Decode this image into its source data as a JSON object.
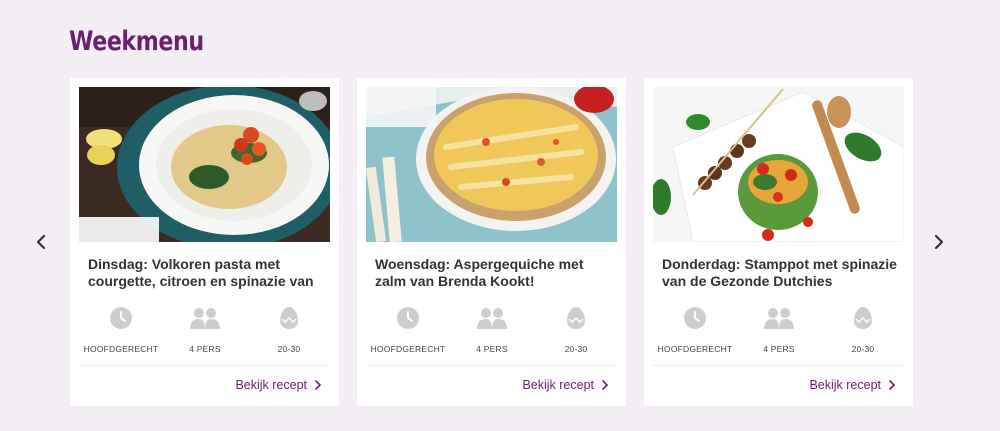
{
  "section": {
    "title": "Weekmenu"
  },
  "colors": {
    "accent": "#6b1f6e",
    "icon": "#cdcdcd",
    "background": "#f3eef3"
  },
  "carousel": {
    "prev_icon": "chevron-left-icon",
    "next_icon": "chevron-right-icon"
  },
  "cards": [
    {
      "title": "Dinsdag: Volkoren pasta met courgette, citroen en spinazie van",
      "image": "pasta-dish",
      "meta": [
        {
          "icon": "clock-icon",
          "label": "HOOFDGERECHT"
        },
        {
          "icon": "people-icon",
          "label": "4 PERS"
        },
        {
          "icon": "egg-icon",
          "label": "20-30"
        }
      ],
      "cta": "Bekijk recept"
    },
    {
      "title": "Woensdag: Aspergequiche met zalm van Brenda Kookt!",
      "image": "quiche-dish",
      "meta": [
        {
          "icon": "clock-icon",
          "label": "HOOFDGERECHT"
        },
        {
          "icon": "people-icon",
          "label": "4 PERS"
        },
        {
          "icon": "egg-icon",
          "label": "20-30"
        }
      ],
      "cta": "Bekijk recept"
    },
    {
      "title": "Donderdag: Stamppot met spinazie van de Gezonde Dutchies",
      "image": "stamppot-dish",
      "meta": [
        {
          "icon": "clock-icon",
          "label": "HOOFDGERECHT"
        },
        {
          "icon": "people-icon",
          "label": "4 PERS"
        },
        {
          "icon": "egg-icon",
          "label": "20-30"
        }
      ],
      "cta": "Bekijk recept"
    }
  ]
}
